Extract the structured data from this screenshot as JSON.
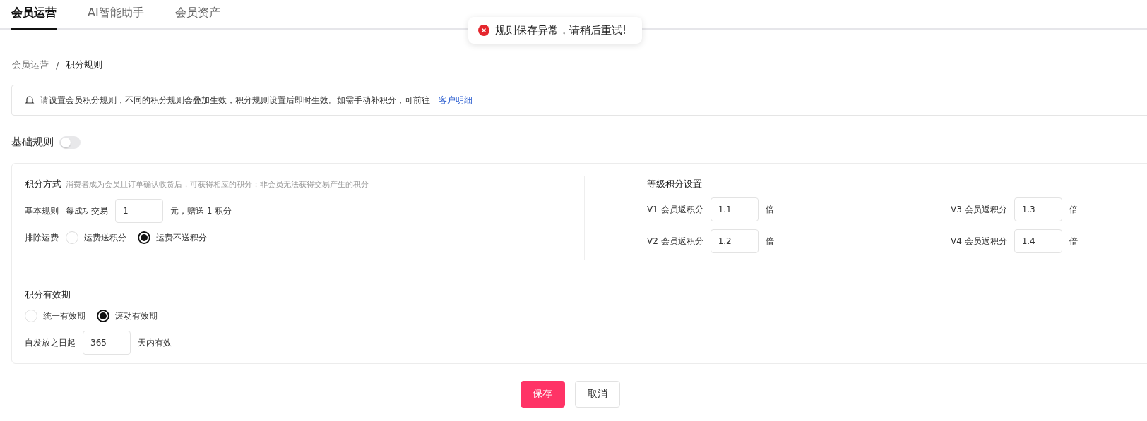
{
  "tabs": [
    {
      "label": "会员运营",
      "selected": true
    },
    {
      "label": "AI智能助手",
      "selected": false
    },
    {
      "label": "会员资产",
      "selected": false
    }
  ],
  "toast": {
    "kind": "error",
    "message": "规则保存异常，请稍后重试!"
  },
  "breadcrumb": [
    "会员运营",
    "积分规则"
  ],
  "breadcrumb_separator": "/",
  "notice": {
    "text": "请设置会员积分规则，不同的积分规则会叠加生效，积分规则设置后即时生效。如需手动补积分，可前往",
    "link": "客户明细"
  },
  "basic_rules": {
    "label": "基础规则",
    "on": false
  },
  "points_method": {
    "title": "积分方式",
    "hint": "消费者成为会员且订单确认收货后，可获得相应的积分；非会员无法获得交易产生的积分",
    "rule_label": "基本规则",
    "rule_prefix": "每成功交易",
    "rule_value": "1",
    "rule_suffix": "元，赠送 1 积分",
    "shipping_label": "排除运费",
    "shipping_options": [
      {
        "label": "运费送积分",
        "selected": false
      },
      {
        "label": "运费不送积分",
        "selected": true
      }
    ]
  },
  "level_points": {
    "title": "等级积分设置",
    "levels": [
      {
        "level": "V1",
        "label": "会员返积分",
        "value": "1.1",
        "unit": "倍"
      },
      {
        "level": "V3",
        "label": "会员返积分",
        "value": "1.3",
        "unit": "倍"
      },
      {
        "level": "V2",
        "label": "会员返积分",
        "value": "1.2",
        "unit": "倍"
      },
      {
        "level": "V4",
        "label": "会员返积分",
        "value": "1.4",
        "unit": "倍"
      }
    ]
  },
  "validity": {
    "title": "积分有效期",
    "options": [
      {
        "label": "统一有效期",
        "selected": false
      },
      {
        "label": "滚动有效期",
        "selected": true
      }
    ],
    "prefix": "自发放之日起",
    "value": "365",
    "suffix": "天内有效"
  },
  "buttons": [
    {
      "label": "保存",
      "kind": "primary"
    },
    {
      "label": "取消",
      "kind": "default"
    }
  ]
}
